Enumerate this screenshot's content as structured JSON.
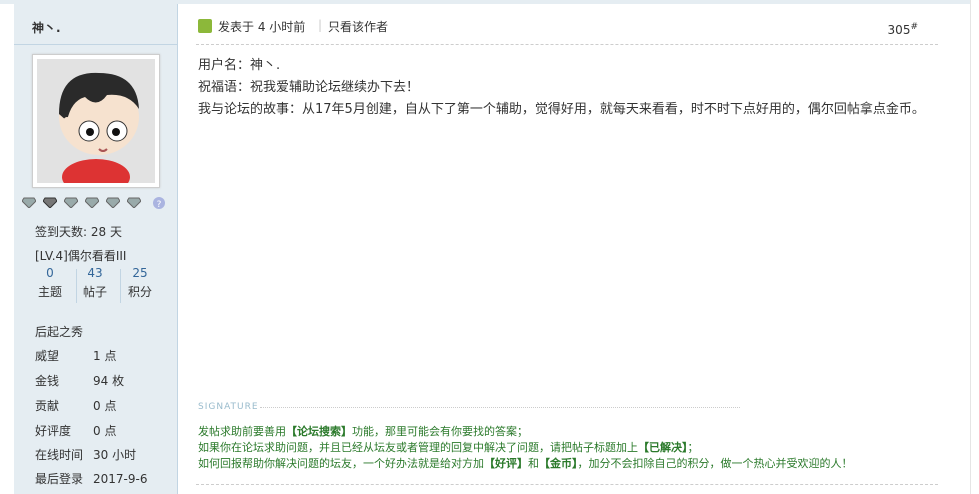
{
  "sidebar": {
    "username": "神丶.",
    "signin_days": "签到天数: 28 天",
    "level": "[LV.4]偶尔看看III",
    "counts": [
      {
        "num": "0",
        "label": "主题"
      },
      {
        "num": "43",
        "label": "帖子"
      },
      {
        "num": "25",
        "label": "积分"
      }
    ],
    "rank": "后起之秀",
    "info": [
      {
        "key": "威望",
        "value": "1 点"
      },
      {
        "key": "金钱",
        "value": "94 枚"
      },
      {
        "key": "贡献",
        "value": "0 点"
      },
      {
        "key": "好评度",
        "value": "0 点"
      },
      {
        "key": "在线时间",
        "value": "30 小时"
      },
      {
        "key": "最后登录",
        "value": "2017-9-6"
      }
    ],
    "medal_icons": [
      "diamond-medal-icon",
      "diamond-medal-icon",
      "diamond-medal-icon",
      "diamond-medal-icon",
      "diamond-medal-icon",
      "diamond-medal-icon",
      "question-icon"
    ]
  },
  "post": {
    "time": "发表于 4 小时前",
    "author_only": "只看该作者",
    "floor": "305",
    "floor_mark": "#",
    "lines": [
      "用户名：神丶.",
      "祝福语：祝我爱辅助论坛继续办下去！",
      "我与论坛的故事：从17年5月创建，自从下了第一个辅助，觉得好用，就每天来看看，时不时下点好用的，偶尔回帖拿点金币。"
    ]
  },
  "signature": {
    "label": "SIGNATURE",
    "line1_a": "发帖求助前要善用",
    "line1_b": "【论坛搜索】",
    "line1_c": "功能，那里可能会有你要找的答案；",
    "line2_a": "如果你在论坛求助问题，并且已经从坛友或者管理的回复中解决了问题，请把帖子标题加上",
    "line2_b": "【已解决】",
    "line2_c": "；",
    "line3_a": "如何回报帮助你解决问题的坛友，一个好办法就是给对方加",
    "line3_b": "【好评】",
    "line3_c": "和",
    "line3_d": "【金币】",
    "line3_e": "，加分不会扣除自己的积分，做一个热心并受欢迎的人！"
  },
  "colors": {
    "sidebar_bg": "#e5edf2",
    "link": "#336699",
    "signature": "#2b7a2b"
  }
}
